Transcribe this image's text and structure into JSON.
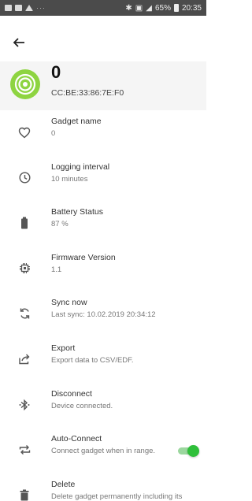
{
  "status_bar": {
    "right_text": "65%",
    "time": "20:35"
  },
  "header": {
    "title": "0",
    "mac": "CC:BE:33:86:7E:F0"
  },
  "items": [
    {
      "icon": "heart-outline-icon",
      "title": "Gadget name",
      "subtitle": "0"
    },
    {
      "icon": "clock-icon",
      "title": "Logging interval",
      "subtitle": "10 minutes"
    },
    {
      "icon": "battery-icon",
      "title": "Battery Status",
      "subtitle": "87 %"
    },
    {
      "icon": "chip-icon",
      "title": "Firmware Version",
      "subtitle": "1.1"
    },
    {
      "icon": "sync-icon",
      "title": "Sync now",
      "subtitle": "Last sync: 10.02.2019 20:34:12"
    },
    {
      "icon": "share-icon",
      "title": "Export",
      "subtitle": "Export data to CSV/EDF."
    },
    {
      "icon": "bluetooth-off-icon",
      "title": "Disconnect",
      "subtitle": "Device connected."
    },
    {
      "icon": "repeat-icon",
      "title": "Auto-Connect",
      "subtitle": "Connect gadget when in range.",
      "toggle_on": true
    },
    {
      "icon": "trash-icon",
      "title": "Delete",
      "subtitle": "Delete gadget permanently including its"
    }
  ],
  "colors": {
    "accent": "#2fbf3a",
    "avatar": "#8ed441",
    "status_bar": "#4b4b4b"
  }
}
